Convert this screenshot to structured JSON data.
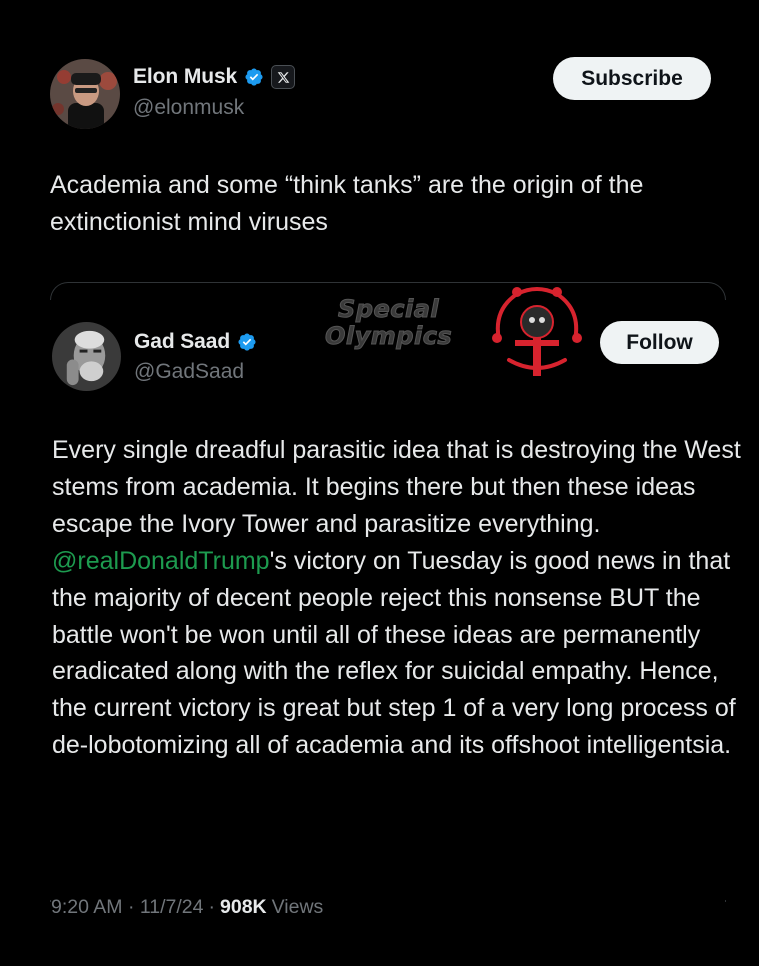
{
  "post": {
    "author": {
      "display_name": "Elon Musk",
      "handle": "@elonmusk",
      "verified_icon": "verified-badge-icon",
      "affiliate_icon": "x-logo-icon"
    },
    "subscribe_label": "Subscribe",
    "text": "Academia and some “think tanks” are the origin of the extinctionist mind viruses",
    "timestamp": "9:20 AM · 11/7/24",
    "separator": "·",
    "views_count": "908K",
    "views_label": "Views"
  },
  "quote": {
    "author": {
      "display_name": "Gad Saad",
      "handle": "@GadSaad",
      "verified_icon": "verified-badge-icon"
    },
    "follow_label": "Follow",
    "text_before_mention": "Every single dreadful parasitic idea that is destroying the West stems from academia.  It begins there but then these ideas escape the Ivory Tower and parasitize everything.  ",
    "mention": "@realDonaldTrump",
    "text_after_mention": "'s victory on Tuesday is good news in that the majority of decent people reject this nonsense BUT the battle won't be won until all of these ideas are permanently eradicated along with the reflex for suicidal empathy.  Hence, the current victory is great but step 1 of a very long process of de-lobotomizing all of academia and its offshoot intelligentsia."
  },
  "overlay": {
    "line1": "Special",
    "line2": "Olympics"
  },
  "colors": {
    "background": "#000000",
    "text": "#e7e9ea",
    "secondary": "#71767b",
    "verified": "#1d9bf0",
    "mention": "#1d9b4f",
    "logo_red": "#d7232e"
  }
}
